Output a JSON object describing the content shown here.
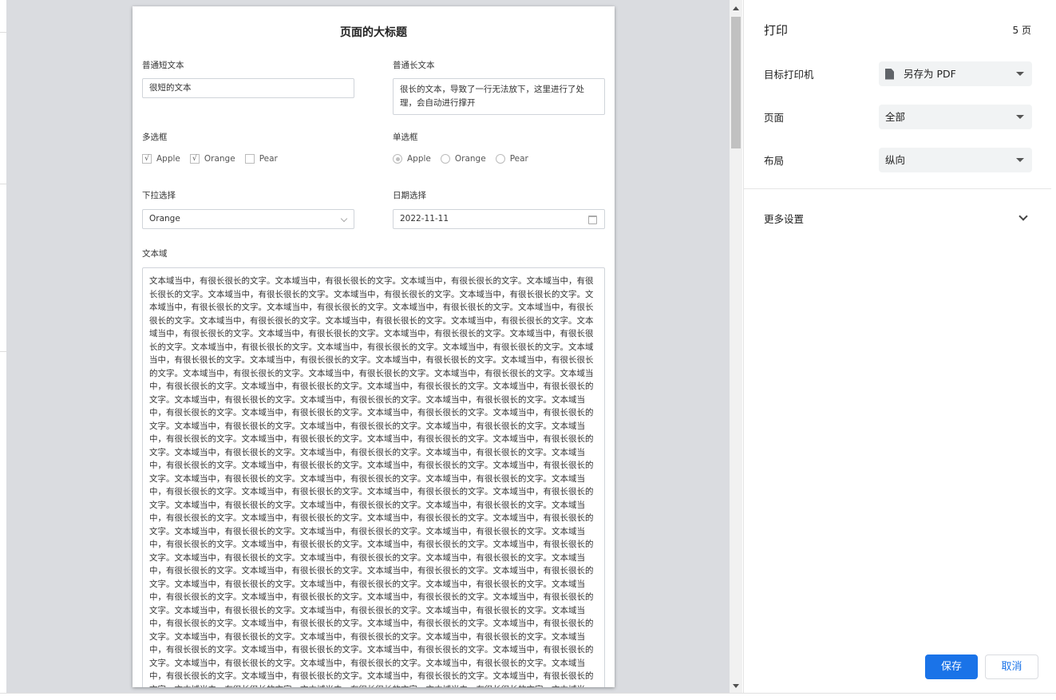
{
  "preview": {
    "page_title": "页面的大标题",
    "short_text": {
      "label": "普通短文本",
      "value": "很短的文本"
    },
    "long_text": {
      "label": "普通长文本",
      "value": "很长的文本，导致了一行无法放下，这里进行了处理，会自动进行撑开"
    },
    "checkboxes": {
      "label": "多选框",
      "items": [
        {
          "label": "Apple",
          "checked": true
        },
        {
          "label": "Orange",
          "checked": true
        },
        {
          "label": "Pear",
          "checked": false
        }
      ]
    },
    "radios": {
      "label": "单选框",
      "items": [
        {
          "label": "Apple",
          "checked": true
        },
        {
          "label": "Orange",
          "checked": false
        },
        {
          "label": "Pear",
          "checked": false
        }
      ]
    },
    "select": {
      "label": "下拉选择",
      "value": "Orange"
    },
    "date": {
      "label": "日期选择",
      "value": "2022-11-11"
    },
    "textarea": {
      "label": "文本域",
      "segment": "文本域当中，有很长很长的文字。",
      "repeat_count": 120
    }
  },
  "print_panel": {
    "title": "打印",
    "page_count": "5 页",
    "printer": {
      "label": "目标打印机",
      "value": "另存为 PDF",
      "icon": "file-icon"
    },
    "pages": {
      "label": "页面",
      "value": "全部"
    },
    "layout": {
      "label": "布局",
      "value": "纵向"
    },
    "more_settings": "更多设置",
    "save_button": "保存",
    "cancel_button": "取消"
  },
  "colors": {
    "primary": "#1a73e8",
    "preview_background": "#dadce0",
    "select_background": "#f1f3f4"
  }
}
